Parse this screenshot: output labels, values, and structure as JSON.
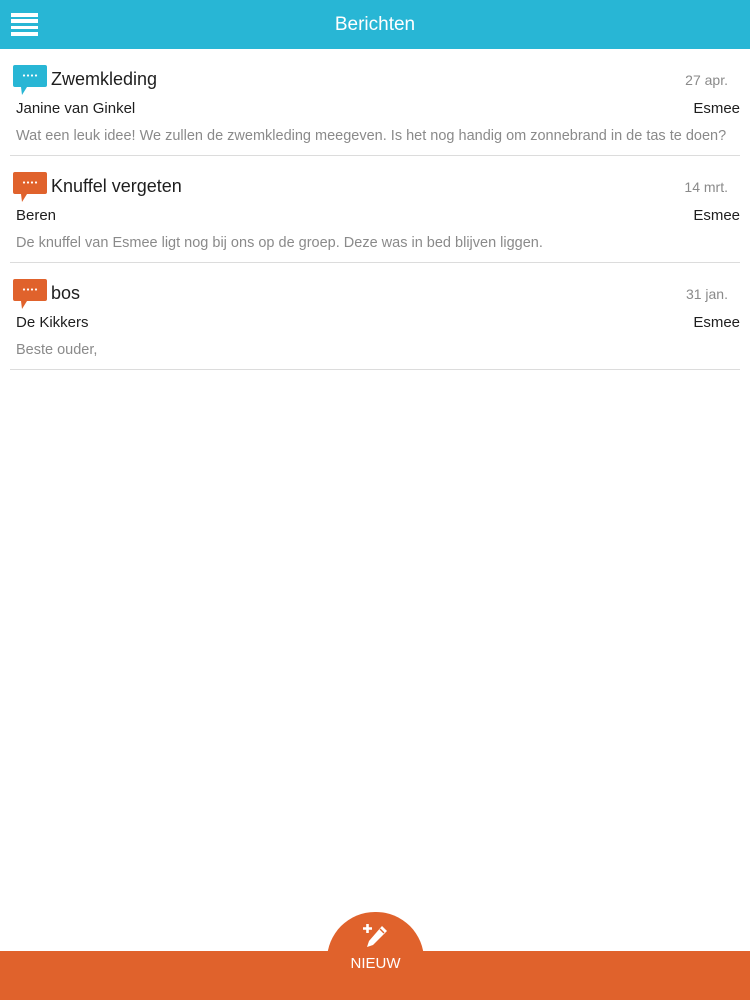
{
  "colors": {
    "header": "#28b6d5",
    "footer": "#e0622c",
    "icon_unread": "#28b6d5",
    "icon_read": "#e0622c",
    "muted_text": "#8a8a8a",
    "divider": "#dcdcdc"
  },
  "header": {
    "title": "Berichten",
    "menu_icon": "hamburger-menu-icon"
  },
  "messages": [
    {
      "icon": "speech-bubble-icon",
      "icon_color": "#28b6d5",
      "subject": "Zwemkleding",
      "date": "27 apr.",
      "sender": "Janine van Ginkel",
      "recipient": "Esmee",
      "preview": "Wat een leuk idee! We zullen de zwemkleding meegeven. Is het nog handig om zonnebrand in de tas te doen?"
    },
    {
      "icon": "speech-bubble-icon",
      "icon_color": "#e0622c",
      "subject": "Knuffel vergeten",
      "date": "14 mrt.",
      "sender": "Beren",
      "recipient": "Esmee",
      "preview": "De knuffel van Esmee ligt nog bij ons op de groep. Deze was in bed blijven liggen."
    },
    {
      "icon": "speech-bubble-icon",
      "icon_color": "#e0622c",
      "subject": "bos",
      "date": "31 jan.",
      "sender": "De Kikkers",
      "recipient": "Esmee",
      "preview": "Beste ouder,"
    }
  ],
  "footer": {
    "new_label": "NIEUW",
    "new_icon": "compose-plus-pencil-icon"
  }
}
